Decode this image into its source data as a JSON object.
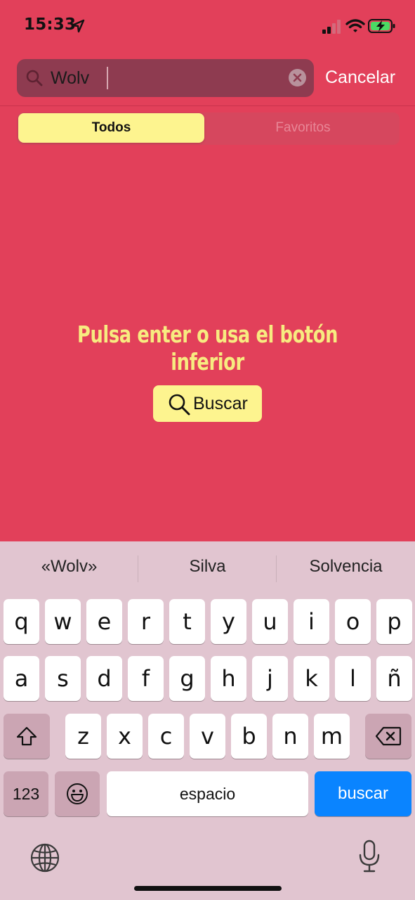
{
  "status_bar": {
    "time": "15:33"
  },
  "search": {
    "value": "Wolv",
    "cancel_label": "Cancelar"
  },
  "segments": {
    "all_label": "Todos",
    "favorites_label": "Favoritos",
    "selected": "Todos"
  },
  "main": {
    "hint": "Pulsa enter o usa el botón inferior",
    "search_button_label": "Buscar"
  },
  "keyboard": {
    "suggestions": [
      "«Wolv»",
      "Silva",
      "Solvencia"
    ],
    "row1": [
      "q",
      "w",
      "e",
      "r",
      "t",
      "y",
      "u",
      "i",
      "o",
      "p"
    ],
    "row2": [
      "a",
      "s",
      "d",
      "f",
      "g",
      "h",
      "j",
      "k",
      "l",
      "ñ"
    ],
    "row3": [
      "z",
      "x",
      "c",
      "v",
      "b",
      "n",
      "m"
    ],
    "numbers_label": "123",
    "space_label": "espacio",
    "go_label": "buscar"
  },
  "colors": {
    "background": "#E2405A",
    "accent_yellow": "#FDF48F",
    "hint_yellow": "#F7EB80",
    "keyboard_bg": "#E1C5D0",
    "go_blue": "#0A84FF"
  }
}
